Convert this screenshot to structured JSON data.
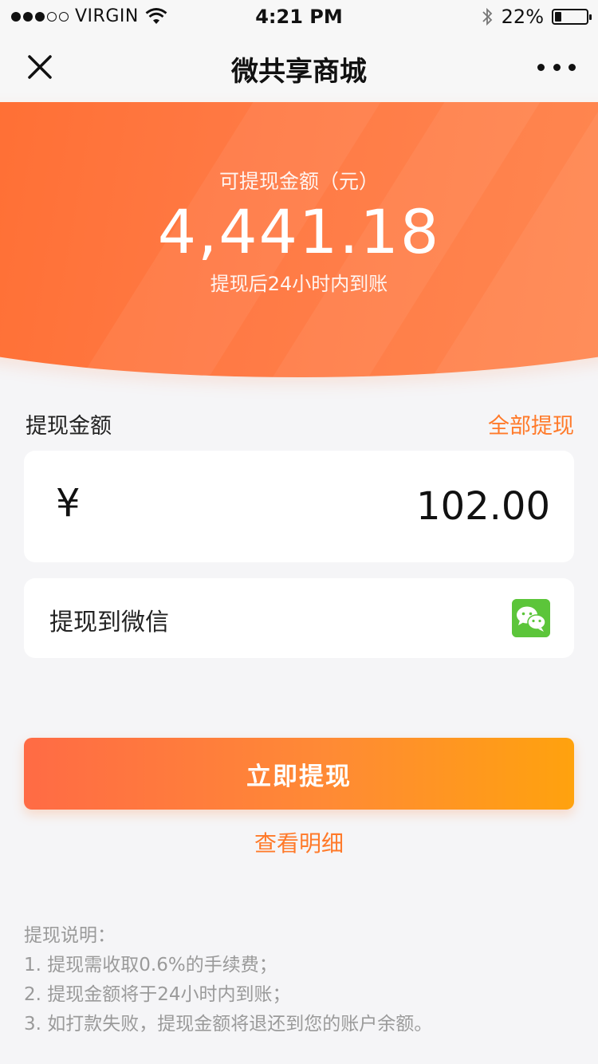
{
  "status_bar": {
    "carrier": "VIRGIN",
    "time": "4:21 PM",
    "battery_percent": "22%",
    "battery_level": 0.22,
    "icons": [
      "signal-dots",
      "wifi-icon",
      "bluetooth-icon",
      "battery-icon"
    ]
  },
  "nav": {
    "title": "微共享商城",
    "close_icon": "close-icon",
    "more_icon": "more-icon"
  },
  "banner": {
    "label": "可提现金额（元）",
    "amount": "4,441.18",
    "note": "提现后24小时内到账",
    "color_start": "#ff6a2c",
    "color_end": "#ff8c55"
  },
  "withdraw": {
    "label": "提现金额",
    "all_link": "全部提现",
    "currency_symbol": "¥",
    "amount_value": "102.00",
    "method_label": "提现到微信",
    "method_icon": "wechat-icon"
  },
  "actions": {
    "submit_label": "立即提现",
    "details_label": "查看明细"
  },
  "notes": {
    "title": "提现说明：",
    "items": [
      "1. 提现需收取0.6%的手续费；",
      "2. 提现金额将于24小时内到账；",
      "3. 如打款失败，提现金额将退还到您的账户余额。"
    ]
  },
  "colors": {
    "accent": "#ff7a2a",
    "wechat_green": "#5cc53a",
    "button_start": "#ff6b45",
    "button_end": "#ffa20e"
  }
}
